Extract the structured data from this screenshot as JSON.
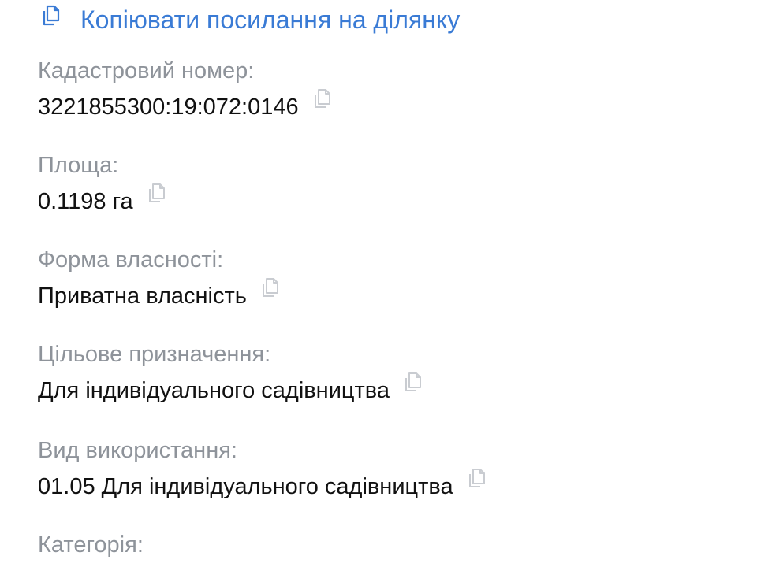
{
  "header": {
    "copy_link_label": "Копіювати посилання на ділянку",
    "copy_link_icon": "copy-icon"
  },
  "colors": {
    "link": "#3a7bd5",
    "label": "#8e939a",
    "value": "#111111",
    "icon": "#c9ccd1"
  },
  "fields": [
    {
      "label": "Кадастровий номер:",
      "value": "3221855300:19:072:0146",
      "icon": "copy-icon"
    },
    {
      "label": "Площа:",
      "value": "0.1198 га",
      "icon": "copy-icon"
    },
    {
      "label": "Форма власності:",
      "value": "Приватна власність",
      "icon": "copy-icon"
    },
    {
      "label": "Цільове призначення:",
      "value": "Для індивідуального садівництва",
      "icon": "copy-icon"
    },
    {
      "label": "Вид використання:",
      "value": "01.05 Для індивідуального садівництва",
      "icon": "copy-icon"
    },
    {
      "label": "Категорія:"
    }
  ]
}
